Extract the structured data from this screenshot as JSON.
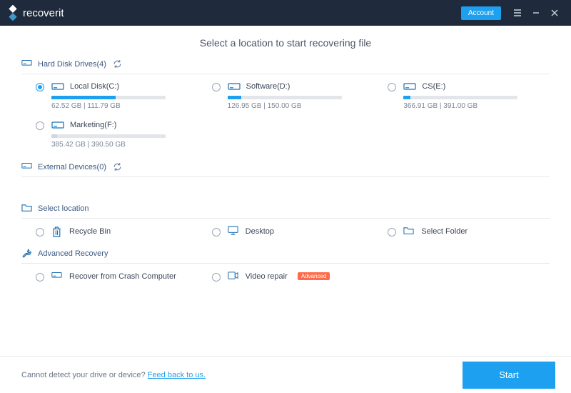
{
  "app": {
    "brand": "recoverit",
    "account_label": "Account"
  },
  "main": {
    "title": "Select a location to start recovering file",
    "sections": {
      "drives": {
        "label": "Hard Disk Drives(4)"
      },
      "external": {
        "label": "External Devices(0)"
      },
      "select_loc": {
        "label": "Select location"
      },
      "advanced": {
        "label": "Advanced Recovery"
      }
    },
    "drives": [
      {
        "name": "Local Disk(C:)",
        "used": "62.52  GB",
        "total": "111.79  GB",
        "pct": 56,
        "selected": true
      },
      {
        "name": "Software(D:)",
        "used": "126.95  GB",
        "total": "150.00  GB",
        "pct": 12,
        "selected": false
      },
      {
        "name": "CS(E:)",
        "used": "366.91  GB",
        "total": "391.00  GB",
        "pct": 6,
        "selected": false
      },
      {
        "name": "Marketing(F:)",
        "used": "385.42  GB",
        "total": "390.50  GB",
        "pct": 5,
        "selected": false
      }
    ],
    "locations": [
      {
        "name": "Recycle Bin"
      },
      {
        "name": "Desktop"
      },
      {
        "name": "Select Folder"
      }
    ],
    "advanced_items": [
      {
        "name": "Recover from Crash Computer"
      },
      {
        "name": "Video repair",
        "badge": "Advanced"
      }
    ]
  },
  "footer": {
    "prefix": "Cannot detect your drive or device? ",
    "link": "Feed back to us.",
    "start": "Start"
  }
}
